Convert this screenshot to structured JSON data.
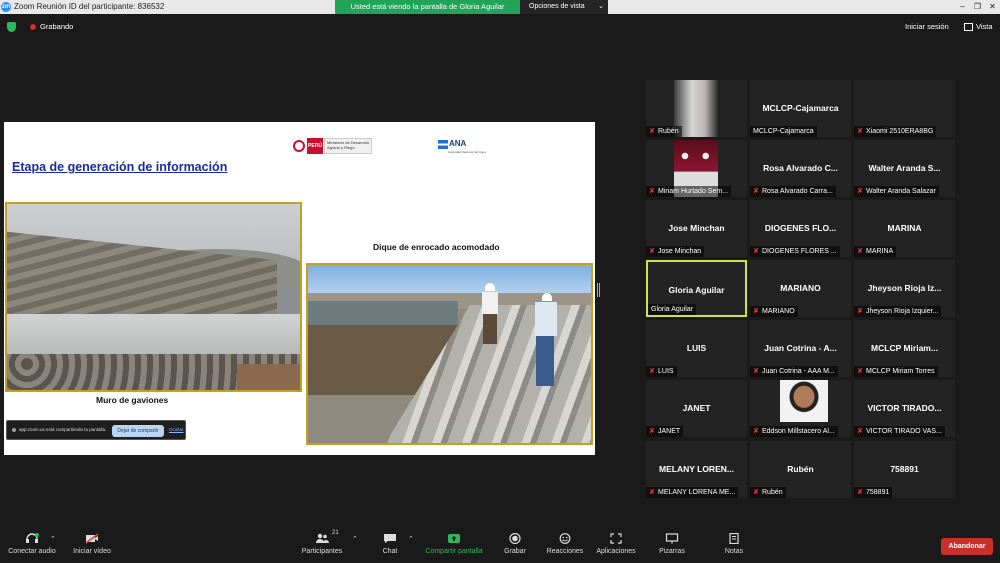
{
  "window": {
    "title": "Zoom Reunión ID del participante: 836532",
    "logo_text": "zm",
    "share_banner": "Usted está viendo la pantalla de Gloria Aguilar",
    "view_options": "Opciones de vista"
  },
  "topbar": {
    "recording": "Grabando",
    "signin": "Iniciar sesión",
    "view": "Vista"
  },
  "slide": {
    "heading": "Etapa de generación de información",
    "peru_label": "PERÚ",
    "ministry_label": "Ministerio de Desarrollo Agrario y Riego",
    "ana_label": "ANA",
    "ana_sub": "Autoridad Nacional del Agua",
    "caption_left": "Muro de gaviones",
    "caption_right": "Dique de enrocado acomodado",
    "share_notice": {
      "text": "app.zoom.us está compartiendo tu pantalla.",
      "stop": "Dejar de compartir",
      "hide": "Ocultar"
    }
  },
  "participants": [
    {
      "center": "",
      "plate": "Rubén",
      "muted": true,
      "photo": "dim"
    },
    {
      "center": "MCLCP-Cajamarca",
      "plate": "MCLCP-Cajamarca",
      "muted": false
    },
    {
      "center": "",
      "plate": "Xiaomi 2510ERA8BG",
      "muted": true
    },
    {
      "center": "",
      "plate": "Miriam Hurtado Sem...",
      "muted": true,
      "photo": "red"
    },
    {
      "center": "Rosa Alvarado C...",
      "plate": "Rosa Alvarado Carra...",
      "muted": true
    },
    {
      "center": "Walter Aranda S...",
      "plate": "Walter Aranda Salazar",
      "muted": true
    },
    {
      "center": "Jose Minchan",
      "plate": "Jose Minchan",
      "muted": true
    },
    {
      "center": "DIOGENES  FLO...",
      "plate": "DIOGENES  FLORES ...",
      "muted": true
    },
    {
      "center": "MARINA",
      "plate": "MARINA",
      "muted": true
    },
    {
      "center": "Gloria Aguilar",
      "plate": "Gloria Aguilar",
      "muted": false,
      "active": true
    },
    {
      "center": "MARIANO",
      "plate": "MARIANO",
      "muted": true
    },
    {
      "center": "Jheyson Rioja Iz...",
      "plate": "Jheyson Rioja Izquier...",
      "muted": true
    },
    {
      "center": "LUIS",
      "plate": "LUIS",
      "muted": true
    },
    {
      "center": "Juan Cotrina - A...",
      "plate": "Juan Cotrina - AAA M...",
      "muted": true
    },
    {
      "center": "MCLCP  Miriam...",
      "plate": "MCLCP Miriam Torres",
      "muted": true
    },
    {
      "center": "JANET",
      "plate": "JANET",
      "muted": true
    },
    {
      "center": "",
      "plate": "Eddson Millstacero Al...",
      "muted": true,
      "photo": "face"
    },
    {
      "center": "VICTOR  TIRADO...",
      "plate": "VICTOR TIRADO VAS...",
      "muted": true
    },
    {
      "center": "MELANY  LOREN...",
      "plate": "MELANY LORENA ME...",
      "muted": true
    },
    {
      "center": "Rubén",
      "plate": "Rubén",
      "muted": true
    },
    {
      "center": "758891",
      "plate": "758891",
      "muted": true
    }
  ],
  "toolbar": {
    "audio": "Conectar audio",
    "video": "Iniciar vídeo",
    "participants": "Participantes",
    "participants_count": "21",
    "chat": "Chat",
    "share": "Compartir pantalla",
    "record": "Grabar",
    "reactions": "Reacciones",
    "apps": "Aplicaciones",
    "whiteboards": "Pizarras",
    "notes": "Notas",
    "end": "Abandonar"
  },
  "colors": {
    "share_banner": "#23a35a",
    "end_button": "#c8302a",
    "active_border": "#c8e64a",
    "muted_icon": "#e53b3b"
  }
}
